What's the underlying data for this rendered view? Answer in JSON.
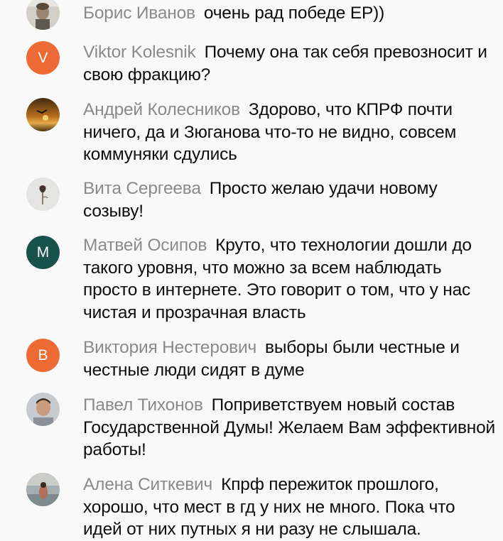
{
  "colors": {
    "background": "#f9f9f9",
    "author": "#8a8a8a",
    "text": "#0d0d0d",
    "avatar_orange": "#ee6a34",
    "avatar_teal": "#17524b"
  },
  "comments": [
    {
      "author": "Борис Иванов",
      "text": "очень рад победе ЕР))",
      "avatar": "photo"
    },
    {
      "author": "Viktor Kolesnik",
      "text": "Почему она так себя превозносит и свою фракцию?",
      "avatar_letter": "V"
    },
    {
      "author": "Андрей Колесников",
      "text": "Здорово, что КПРФ почти ничего, да и Зюганова что-то не видно, совсем коммуняки сдулись",
      "avatar": "photo"
    },
    {
      "author": "Вита Сергеева",
      "text": "Просто желаю удачи новому созыву!",
      "avatar": "photo"
    },
    {
      "author": "Матвей Осипов",
      "text": "Круто, что технологии дошли до такого уровня, что можно за всем наблюдать просто в интернете. Это говорит о том, что у нас чистая и прозрачная власть",
      "avatar_letter": "M"
    },
    {
      "author": "Виктория Нестерович",
      "text": "выборы были честные и честные люди сидят в думе",
      "avatar_letter": "B"
    },
    {
      "author": "Павел Тихонов",
      "text": "Поприветствуем новый состав Государственной Думы! Желаем Вам эффективной работы!",
      "avatar": "photo"
    },
    {
      "author": "Алена Ситкевич",
      "text": "Кпрф пережиток прошлого, хорошо, что мест в гд у них не много. Пока что идей от них путных я ни разу не слышала.",
      "avatar": "photo"
    }
  ]
}
